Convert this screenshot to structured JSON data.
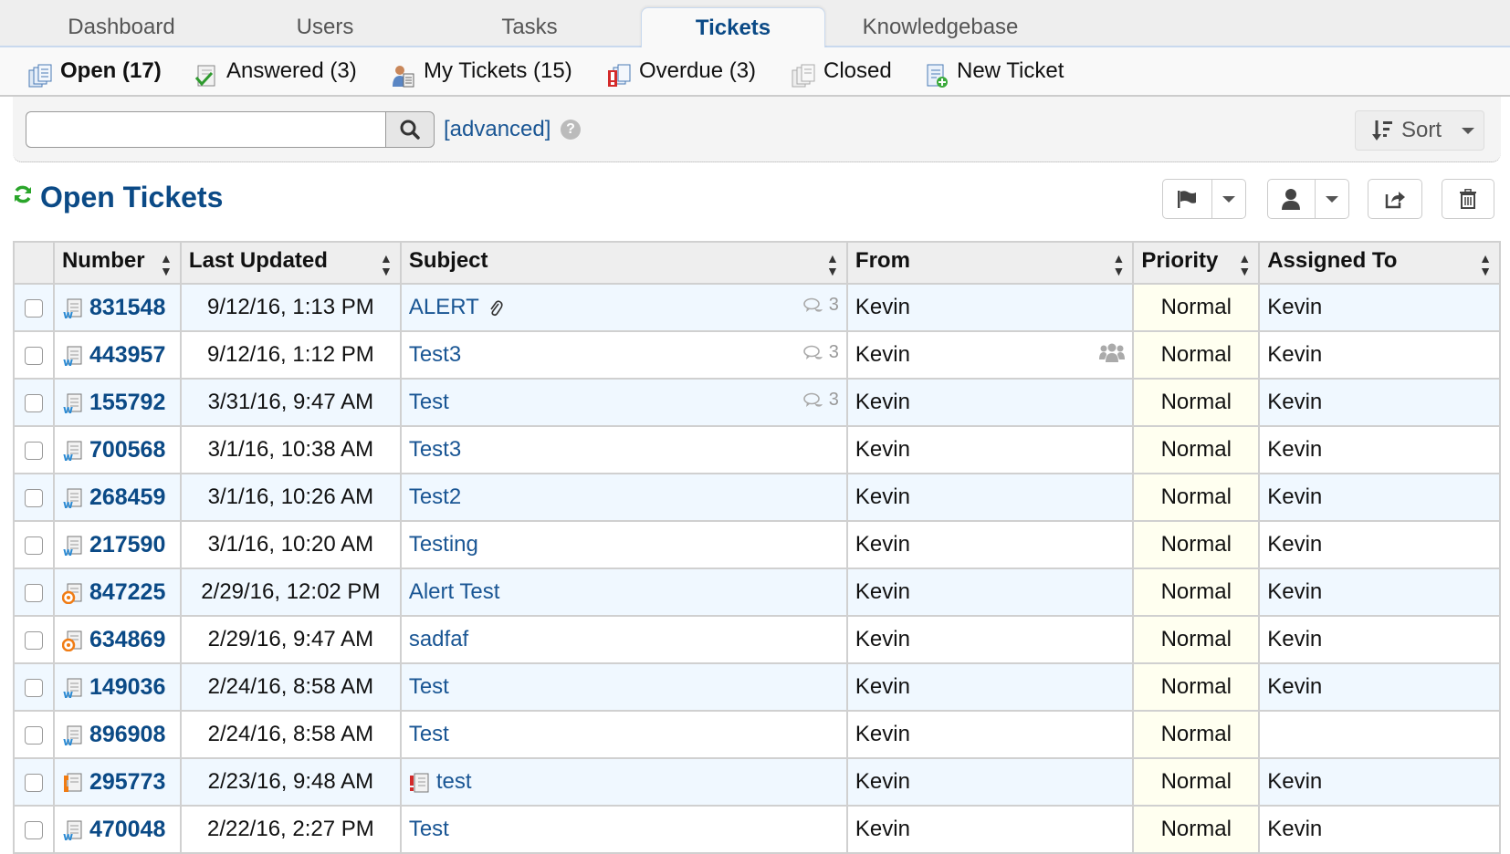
{
  "topnav": {
    "tabs": [
      {
        "label": "Dashboard",
        "active": false
      },
      {
        "label": "Users",
        "active": false
      },
      {
        "label": "Tasks",
        "active": false
      },
      {
        "label": "Tickets",
        "active": true
      },
      {
        "label": "Knowledgebase",
        "active": false
      }
    ]
  },
  "subnav": {
    "items": [
      {
        "label": "Open (17)",
        "icon": "open-tickets-icon",
        "active": true
      },
      {
        "label": "Answered (3)",
        "icon": "answered-icon",
        "active": false
      },
      {
        "label": "My Tickets (15)",
        "icon": "my-tickets-icon",
        "active": false
      },
      {
        "label": "Overdue (3)",
        "icon": "overdue-icon",
        "active": false
      },
      {
        "label": "Closed",
        "icon": "closed-icon",
        "active": false
      },
      {
        "label": "New Ticket",
        "icon": "new-ticket-icon",
        "active": false
      }
    ]
  },
  "search": {
    "value": "",
    "placeholder": "",
    "advanced_label": "[advanced]",
    "help": "?",
    "sort_label": "Sort"
  },
  "page": {
    "title": "Open Tickets"
  },
  "colors": {
    "accent": "#0b4a86",
    "link": "#1a5694",
    "refresh": "#2aa52a",
    "row_alt": "#f0f8ff",
    "priority_bg": "#fffff0"
  },
  "table": {
    "columns": [
      "Number",
      "Last Updated",
      "Subject",
      "From",
      "Priority",
      "Assigned To"
    ],
    "rows": [
      {
        "number": "831548",
        "icon": "web-ticket",
        "updated": "9/12/16, 1:13 PM",
        "subject": "ALERT",
        "attachment": true,
        "threads": "3",
        "from": "Kevin",
        "collab": false,
        "priority": "Normal",
        "assigned": "Kevin",
        "subject_flag": false
      },
      {
        "number": "443957",
        "icon": "web-ticket",
        "updated": "9/12/16, 1:12 PM",
        "subject": "Test3",
        "attachment": false,
        "threads": "3",
        "from": "Kevin",
        "collab": true,
        "priority": "Normal",
        "assigned": "Kevin",
        "subject_flag": false
      },
      {
        "number": "155792",
        "icon": "web-ticket",
        "updated": "3/31/16, 9:47 AM",
        "subject": "Test",
        "attachment": false,
        "threads": "3",
        "from": "Kevin",
        "collab": false,
        "priority": "Normal",
        "assigned": "Kevin",
        "subject_flag": false
      },
      {
        "number": "700568",
        "icon": "web-ticket",
        "updated": "3/1/16, 10:38 AM",
        "subject": "Test3",
        "attachment": false,
        "threads": "",
        "from": "Kevin",
        "collab": false,
        "priority": "Normal",
        "assigned": "Kevin",
        "subject_flag": false
      },
      {
        "number": "268459",
        "icon": "web-ticket",
        "updated": "3/1/16, 10:26 AM",
        "subject": "Test2",
        "attachment": false,
        "threads": "",
        "from": "Kevin",
        "collab": false,
        "priority": "Normal",
        "assigned": "Kevin",
        "subject_flag": false
      },
      {
        "number": "217590",
        "icon": "web-ticket",
        "updated": "3/1/16, 10:20 AM",
        "subject": "Testing",
        "attachment": false,
        "threads": "",
        "from": "Kevin",
        "collab": false,
        "priority": "Normal",
        "assigned": "Kevin",
        "subject_flag": false
      },
      {
        "number": "847225",
        "icon": "email-ticket",
        "updated": "2/29/16, 12:02 PM",
        "subject": "Alert Test",
        "attachment": false,
        "threads": "",
        "from": "Kevin",
        "collab": false,
        "priority": "Normal",
        "assigned": "Kevin",
        "subject_flag": false
      },
      {
        "number": "634869",
        "icon": "email-ticket",
        "updated": "2/29/16, 9:47 AM",
        "subject": "sadfaf",
        "attachment": false,
        "threads": "",
        "from": "Kevin",
        "collab": false,
        "priority": "Normal",
        "assigned": "Kevin",
        "subject_flag": false
      },
      {
        "number": "149036",
        "icon": "web-ticket",
        "updated": "2/24/16, 8:58 AM",
        "subject": "Test",
        "attachment": false,
        "threads": "",
        "from": "Kevin",
        "collab": false,
        "priority": "Normal",
        "assigned": "Kevin",
        "subject_flag": false
      },
      {
        "number": "896908",
        "icon": "web-ticket",
        "updated": "2/24/16, 8:58 AM",
        "subject": "Test",
        "attachment": false,
        "threads": "",
        "from": "Kevin",
        "collab": false,
        "priority": "Normal",
        "assigned": "",
        "subject_flag": false
      },
      {
        "number": "295773",
        "icon": "phone-ticket",
        "updated": "2/23/16, 9:48 AM",
        "subject": "test",
        "attachment": false,
        "threads": "",
        "from": "Kevin",
        "collab": false,
        "priority": "Normal",
        "assigned": "Kevin",
        "subject_flag": true
      },
      {
        "number": "470048",
        "icon": "web-ticket",
        "updated": "2/22/16, 2:27 PM",
        "subject": "Test",
        "attachment": false,
        "threads": "",
        "from": "Kevin",
        "collab": false,
        "priority": "Normal",
        "assigned": "Kevin",
        "subject_flag": false
      }
    ]
  }
}
